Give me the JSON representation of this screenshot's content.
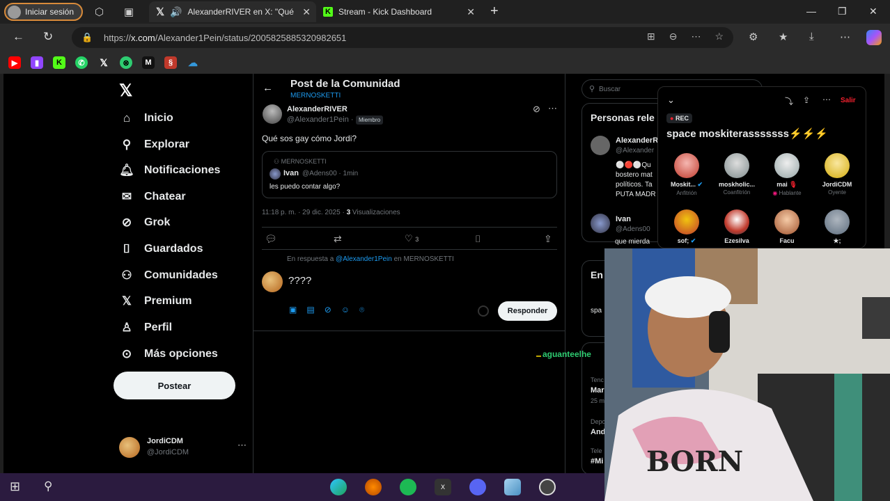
{
  "browser": {
    "profile_label": "Iniciar sesión",
    "tabs": [
      {
        "label": "AlexanderRIVER en X: \"Qué"
      },
      {
        "label": "Stream - Kick Dashboard"
      }
    ],
    "url_prefix": "https://",
    "url_domain": "x.com",
    "url_path": "/Alexander1Pein/status/2005825885320982651"
  },
  "x_nav": {
    "items": [
      {
        "label": "Inicio",
        "icon": "home-icon"
      },
      {
        "label": "Explorar",
        "icon": "search-icon"
      },
      {
        "label": "Notificaciones",
        "icon": "bell-icon"
      },
      {
        "label": "Chatear",
        "icon": "mail-icon"
      },
      {
        "label": "Grok",
        "icon": "grok-icon"
      },
      {
        "label": "Guardados",
        "icon": "bookmark-icon"
      },
      {
        "label": "Comunidades",
        "icon": "people-icon"
      },
      {
        "label": "Premium",
        "icon": "x-icon"
      },
      {
        "label": "Perfil",
        "icon": "person-icon"
      },
      {
        "label": "Más opciones",
        "icon": "more-circle-icon"
      }
    ],
    "post_button": "Postear",
    "account_name": "JordiCDM",
    "account_handle": "@JordiCDM"
  },
  "post": {
    "header_title": "Post de la Comunidad",
    "header_subtitle": "MERNOSKETTI",
    "author_name": "AlexanderRIVER",
    "author_handle": "@Alexander1Pein ·",
    "member_badge": "Miembro",
    "text": "Qué sos gay cómo Jordi?",
    "quote_community": "MERNOSKETTI",
    "quote_author": "Ivan",
    "quote_handle": "@Adens00 · 1min",
    "quote_text": "les puedo contar algo?",
    "meta_time": "11:18 p. m. · 29 dic. 2025 ·",
    "meta_views_count": "3",
    "meta_views_label": "Visualizaciones",
    "likes": "3",
    "reply_to_prefix": "En respuesta a",
    "reply_to_handle": "@Alexander1Pein",
    "reply_to_suffix": "en MERNOSKETTI",
    "reply_text": "????",
    "reply_button": "Responder"
  },
  "chat_overlay": {
    "text": "aguanteelhe"
  },
  "right_column": {
    "search_placeholder": "Buscar",
    "people_title": "Personas rele",
    "person1_name": "AlexanderR",
    "person1_handle": "@Alexander",
    "person1_bio_l1": "Qu",
    "person1_bio_l2": "bostero mat",
    "person1_bio_l3": "políticos. Ta",
    "person1_bio_l4": "PUTA MADR",
    "person2_name": "Ivan",
    "person2_handle": "@Adens00",
    "person2_bio": "que mierda",
    "en_title": "En",
    "en_l1": "spa",
    "tend_l1": "Tenc",
    "tend_l2": "Mar",
    "tend_l3": "25 m",
    "dep_l1": "Depo",
    "dep_l2": "And",
    "tel_l1": "Tele",
    "tel_l2": "#Mi"
  },
  "spaces": {
    "rec_label": "REC",
    "exit_label": "Salir",
    "title": "space moskiterasssssss⚡⚡⚡",
    "speakers": [
      {
        "name": "Moskit...",
        "role": "Anfitrión",
        "color": "#c0392b"
      },
      {
        "name": "moskholic...",
        "role": "Coanfitrión",
        "color": "#7f8c8d"
      },
      {
        "name": "mai",
        "role": "Hablante",
        "color": "#95a5a6"
      },
      {
        "name": "JordiCDM",
        "role": "Oyente",
        "color": "#d4ac0d"
      },
      {
        "name": "sof;",
        "role": "",
        "color": "#c0392b"
      },
      {
        "name": "Ezesilva",
        "role": "",
        "color": "#2c3e50"
      },
      {
        "name": "Facu",
        "role": "",
        "color": "#a0522d"
      },
      {
        "name": "★;",
        "role": "",
        "color": "#5d6d7e"
      }
    ]
  },
  "colors": {
    "x_blue": "#1d9bf0",
    "kick_green": "#53fc18",
    "taskbar": "#2b1b3f"
  }
}
